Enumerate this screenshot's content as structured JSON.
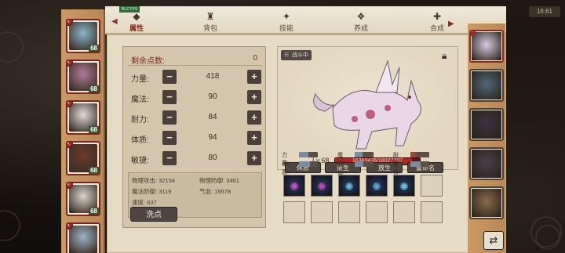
{
  "top_bar": {
    "version_tag": "BLZ FPS",
    "time_badge": "16:61",
    "tabs": [
      {
        "label": "属性",
        "icon": "attribute-icon",
        "active": true
      },
      {
        "label": "背包",
        "icon": "bag-icon",
        "active": false
      },
      {
        "label": "技能",
        "icon": "skill-icon",
        "active": false
      },
      {
        "label": "养成",
        "icon": "train-icon",
        "active": false
      },
      {
        "label": "合成",
        "icon": "merge-icon",
        "active": false
      }
    ]
  },
  "heroes": [
    {
      "level": "68",
      "accent": "#88b6c8"
    },
    {
      "level": "68",
      "accent": "#b07a9a"
    },
    {
      "level": "68",
      "accent": "#e0dcd4"
    },
    {
      "level": "68",
      "accent": "#6b3a2c"
    },
    {
      "level": "68",
      "accent": "#d8d4cc"
    },
    {
      "level": "",
      "accent": "#9ab4c8"
    }
  ],
  "attributes": {
    "remaining_label": "剩余点数:",
    "remaining_value": "0",
    "stats": [
      {
        "label": "力量:",
        "value": "418"
      },
      {
        "label": "魔法:",
        "value": "90"
      },
      {
        "label": "耐力:",
        "value": "84"
      },
      {
        "label": "体质:",
        "value": "94"
      },
      {
        "label": "敏捷:",
        "value": "80"
      }
    ],
    "sub_stats": [
      {
        "label": "物理攻击:",
        "value": "32154"
      },
      {
        "label": "物理防御:",
        "value": "3461"
      },
      {
        "label": "魔法防御:",
        "value": "3119"
      },
      {
        "label": "气血:",
        "value": "19578"
      },
      {
        "label": "速度:",
        "value": "637"
      }
    ],
    "wash_label": "洗点"
  },
  "pet": {
    "tag": "战斗中",
    "level": "Lv.68",
    "hp_text": "16369436/18027707",
    "hp_fraction": 0.91,
    "buttons": [
      "休息",
      "重生",
      "放生",
      "重命名"
    ],
    "stats_left": [
      {
        "label": "力量:",
        "fraction": 0.5
      },
      {
        "label": "体质:",
        "fraction": 0.6
      }
    ],
    "stats_mid": [
      {
        "label": "魔法:",
        "fraction": 0.4
      },
      {
        "label": "敏捷:",
        "fraction": 0.45
      }
    ],
    "stats_right": [
      {
        "label": "耐力:",
        "fraction": 0.3
      },
      {
        "label": "根骨:",
        "fraction": 0.55
      }
    ]
  },
  "skills": {
    "filled": [
      {
        "icon": "claw-skill-icon",
        "color": "#d04bd0"
      },
      {
        "icon": "burst-skill-icon",
        "color": "#c646c8"
      },
      {
        "icon": "wind-skill-icon",
        "color": "#63b6e0"
      },
      {
        "icon": "vortex-skill-icon",
        "color": "#58a8d8"
      },
      {
        "icon": "shock-skill-icon",
        "color": "#6fc0e0"
      }
    ],
    "empty_count": 6
  },
  "pet_list": [
    {
      "name": "",
      "level": "",
      "active": true
    },
    {
      "name": "",
      "level": "",
      "active": false
    },
    {
      "name": "",
      "level": "",
      "active": false
    },
    {
      "name": "",
      "level": "",
      "active": false
    },
    {
      "name": "",
      "level": "",
      "active": false
    }
  ],
  "colors": {
    "accent_red": "#8b2a1f",
    "panel": "#e6dcc6",
    "button_dark": "#4e4540"
  }
}
